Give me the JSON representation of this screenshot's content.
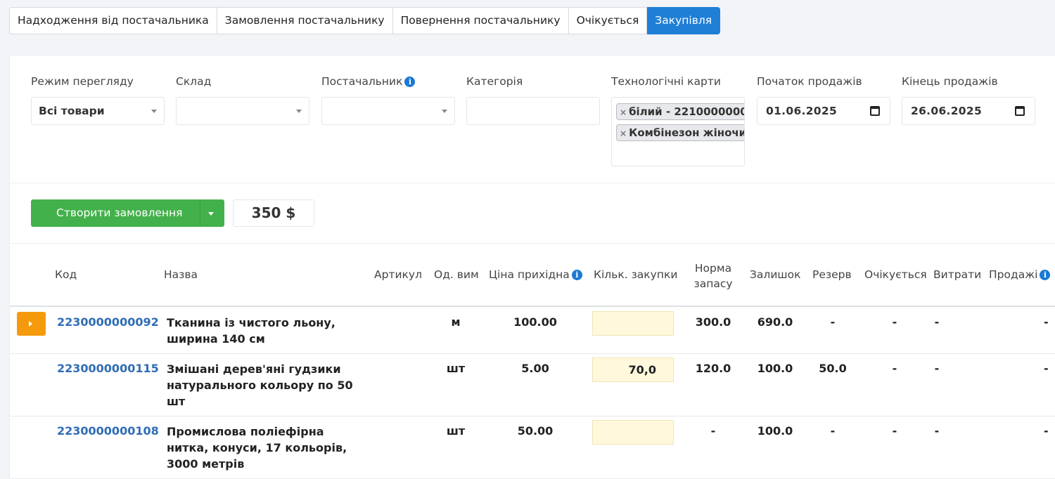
{
  "tabs": [
    {
      "label": "Надходження від постачальника"
    },
    {
      "label": "Замовлення постачальнику"
    },
    {
      "label": "Повернення постачальнику"
    },
    {
      "label": "Очікується"
    },
    {
      "label": "Закупівля",
      "active": true
    }
  ],
  "filters": {
    "view_mode": {
      "label": "Режим перегляду",
      "value": "Всі товари"
    },
    "warehouse": {
      "label": "Склад",
      "value": ""
    },
    "supplier": {
      "label": "Постачальник",
      "value": ""
    },
    "category": {
      "label": "Категорія",
      "value": ""
    },
    "tech_cards": {
      "label": "Технологічні карти",
      "chips": [
        "білий - 2210000000",
        "Комбінезон жіночи"
      ]
    },
    "sales_start": {
      "label": "Початок продажів",
      "value": "01.06.2025"
    },
    "sales_end": {
      "label": "Кінець продажів",
      "value": "26.06.2025"
    }
  },
  "actions": {
    "create_order": "Створити замовлення",
    "total": "350 $"
  },
  "table": {
    "headers": {
      "code": "Код",
      "name": "Назва",
      "article": "Артикул",
      "unit": "Од. вим",
      "price": "Ціна прихідна",
      "qty": "Кільк. закупки",
      "norm_1": "Норма",
      "norm_2": "запасу",
      "stock": "Залишок",
      "reserve": "Резерв",
      "expected": "Очікується",
      "costs": "Витрати",
      "sales": "Продажі"
    },
    "rows": [
      {
        "code": "2230000000092",
        "name": "Тканина із чистого льону, ширина 140 см",
        "unit": "м",
        "price": "100.00",
        "qty": "",
        "norm": "300.0",
        "stock": "690.0",
        "reserve": "-",
        "expected": "-",
        "costs": "-",
        "sales": "-"
      },
      {
        "code": "2230000000115",
        "name": "Змішані дерев'яні гудзики натурального кольору по 50 шт",
        "unit": "шт",
        "price": "5.00",
        "qty": "70,0",
        "norm": "120.0",
        "stock": "100.0",
        "reserve": "50.0",
        "expected": "-",
        "costs": "-",
        "sales": "-"
      },
      {
        "code": "2230000000108",
        "name": "Промислова поліефірна нитка, конуси, 17 кольорів, 3000 метрів",
        "unit": "шт",
        "price": "50.00",
        "qty": "",
        "norm": "-",
        "stock": "100.0",
        "reserve": "-",
        "expected": "-",
        "costs": "-",
        "sales": "-"
      }
    ]
  }
}
